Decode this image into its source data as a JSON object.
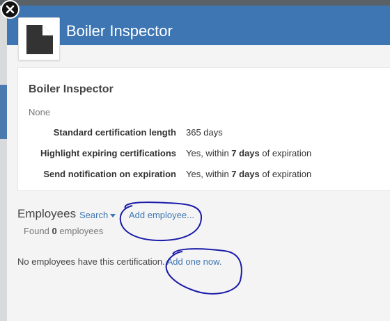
{
  "modal": {
    "title": "Boiler Inspector",
    "icon": "document-icon",
    "close_icon": "close-icon"
  },
  "details": {
    "name": "Boiler Inspector",
    "description": "None",
    "rows": [
      {
        "label": "Standard certification length",
        "value_prefix": "365 days",
        "value_bold": "",
        "value_suffix": ""
      },
      {
        "label": "Highlight expiring certifications",
        "value_prefix": "Yes, within ",
        "value_bold": "7 days",
        "value_suffix": " of expiration"
      },
      {
        "label": "Send notification on expiration",
        "value_prefix": "Yes, within ",
        "value_bold": "7 days",
        "value_suffix": " of expiration"
      }
    ]
  },
  "employees": {
    "title": "Employees",
    "search_label": "Search",
    "add_label": "Add employee...",
    "found_prefix": "Found ",
    "found_count": "0",
    "found_suffix": " employees",
    "empty_message": "No employees have this certification.",
    "add_one_label": "Add one now."
  },
  "colors": {
    "header": "#3d76b2",
    "link": "#3d76b2",
    "annotation": "#1a1aa8"
  }
}
